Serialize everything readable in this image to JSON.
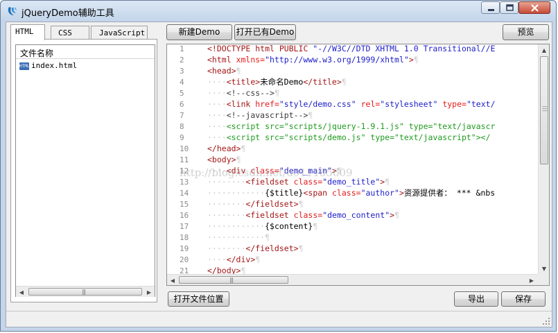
{
  "window": {
    "title": "jQueryDemo辅助工具",
    "minimize": "minimize",
    "maximize": "maximize",
    "close": "close"
  },
  "tabs": [
    {
      "label": "HTML",
      "active": true
    },
    {
      "label": "CSS",
      "active": false
    },
    {
      "label": "JavaScript",
      "active": false
    }
  ],
  "file_list": {
    "header": "文件名称",
    "items": [
      {
        "name": "index.html",
        "icon": "html-file-icon"
      }
    ]
  },
  "toolbar": {
    "new_demo": "新建Demo",
    "open_demo": "打开已有Demo",
    "preview": "预览"
  },
  "editor": {
    "watermark": "http://blog.csdn.net/u011185609",
    "lines": [
      {
        "n": "1",
        "segs": [
          [
            "txt",
            ""
          ],
          [
            "tag",
            "<!DOCTYPE html PUBLIC "
          ],
          [
            "val",
            "\"-//W3C//DTD XHTML 1.0 Transitional//E"
          ]
        ]
      },
      {
        "n": "2",
        "segs": [
          [
            "tag",
            "<html "
          ],
          [
            "attr",
            "xmlns="
          ],
          [
            "val",
            "\"http://www.w3.org/1999/xhtml\""
          ],
          [
            "tag",
            ">"
          ],
          [
            "eol",
            "¶"
          ]
        ]
      },
      {
        "n": "3",
        "segs": [
          [
            "tag",
            "<head>"
          ],
          [
            "eol",
            "¶"
          ]
        ]
      },
      {
        "n": "4",
        "segs": [
          [
            "ind",
            "····"
          ],
          [
            "tag",
            "<title>"
          ],
          [
            "txt",
            "未命名Demo"
          ],
          [
            "tag",
            "</title>"
          ],
          [
            "eol",
            "¶"
          ]
        ]
      },
      {
        "n": "5",
        "segs": [
          [
            "ind",
            "····"
          ],
          [
            "com",
            "<!--css-->"
          ],
          [
            "eol",
            "¶"
          ]
        ]
      },
      {
        "n": "6",
        "segs": [
          [
            "ind",
            "····"
          ],
          [
            "tag",
            "<link "
          ],
          [
            "attr",
            "href="
          ],
          [
            "val",
            "\"style/demo.css\""
          ],
          [
            "txt",
            " "
          ],
          [
            "attr",
            "rel="
          ],
          [
            "val",
            "\"stylesheet\""
          ],
          [
            "txt",
            " "
          ],
          [
            "attr",
            "type="
          ],
          [
            "val",
            "\"text/"
          ]
        ]
      },
      {
        "n": "7",
        "segs": [
          [
            "ind",
            "····"
          ],
          [
            "com",
            "<!--javascript-->"
          ],
          [
            "eol",
            "¶"
          ]
        ]
      },
      {
        "n": "8",
        "segs": [
          [
            "ind",
            "····"
          ],
          [
            "scr",
            "<script src=\"scripts/jquery-1.9.1.js\" type=\"text/javascr"
          ]
        ]
      },
      {
        "n": "9",
        "segs": [
          [
            "ind",
            "····"
          ],
          [
            "scr",
            "<script src=\"scripts/demo.js\" type=\"text/javascript\"></"
          ]
        ]
      },
      {
        "n": "10",
        "segs": [
          [
            "tag",
            "</head>"
          ],
          [
            "eol",
            "¶"
          ]
        ]
      },
      {
        "n": "11",
        "segs": [
          [
            "tag",
            "<body>"
          ],
          [
            "eol",
            "¶"
          ]
        ]
      },
      {
        "n": "12",
        "segs": [
          [
            "ind",
            "····"
          ],
          [
            "tag",
            "<div "
          ],
          [
            "attr",
            "class="
          ],
          [
            "val",
            "\"demo_main\""
          ],
          [
            "tag",
            ">"
          ],
          [
            "eol",
            "¶"
          ]
        ]
      },
      {
        "n": "13",
        "segs": [
          [
            "ind",
            "········"
          ],
          [
            "tag",
            "<fieldset "
          ],
          [
            "attr",
            "class="
          ],
          [
            "val",
            "\"demo_title\""
          ],
          [
            "tag",
            ">"
          ],
          [
            "eol",
            "¶"
          ]
        ]
      },
      {
        "n": "14",
        "segs": [
          [
            "ind",
            "············"
          ],
          [
            "txt",
            "{$title}"
          ],
          [
            "tag",
            "<span "
          ],
          [
            "attr",
            "class="
          ],
          [
            "val",
            "\"author\""
          ],
          [
            "tag",
            ">"
          ],
          [
            "txt",
            "资源提供者： *** &nbs"
          ]
        ]
      },
      {
        "n": "15",
        "segs": [
          [
            "ind",
            "········"
          ],
          [
            "tag",
            "</fieldset>"
          ],
          [
            "eol",
            "¶"
          ]
        ]
      },
      {
        "n": "16",
        "segs": [
          [
            "ind",
            "········"
          ],
          [
            "tag",
            "<fieldset "
          ],
          [
            "attr",
            "class="
          ],
          [
            "val",
            "\"demo_content\""
          ],
          [
            "tag",
            ">"
          ],
          [
            "eol",
            "¶"
          ]
        ]
      },
      {
        "n": "17",
        "segs": [
          [
            "ind",
            "············"
          ],
          [
            "txt",
            "{$content}"
          ],
          [
            "eol",
            "¶"
          ]
        ]
      },
      {
        "n": "18",
        "segs": [
          [
            "ind",
            "············"
          ],
          [
            "eol",
            "¶"
          ]
        ]
      },
      {
        "n": "19",
        "segs": [
          [
            "ind",
            "········"
          ],
          [
            "tag",
            "</fieldset>"
          ],
          [
            "eol",
            "¶"
          ]
        ]
      },
      {
        "n": "20",
        "segs": [
          [
            "ind",
            "····"
          ],
          [
            "tag",
            "</div>"
          ],
          [
            "eol",
            "¶"
          ]
        ]
      },
      {
        "n": "21",
        "segs": [
          [
            "tag",
            "</body>"
          ],
          [
            "eol",
            "¶"
          ]
        ]
      }
    ]
  },
  "bottom_bar": {
    "open_location": "打开文件位置",
    "export": "导出",
    "save": "保存"
  },
  "colors": {
    "tag": "#a31515",
    "attr": "#e41b1b",
    "value": "#1d1dc9",
    "script": "#1e9b1e",
    "whitespace_marker": "#c8c8c8"
  }
}
